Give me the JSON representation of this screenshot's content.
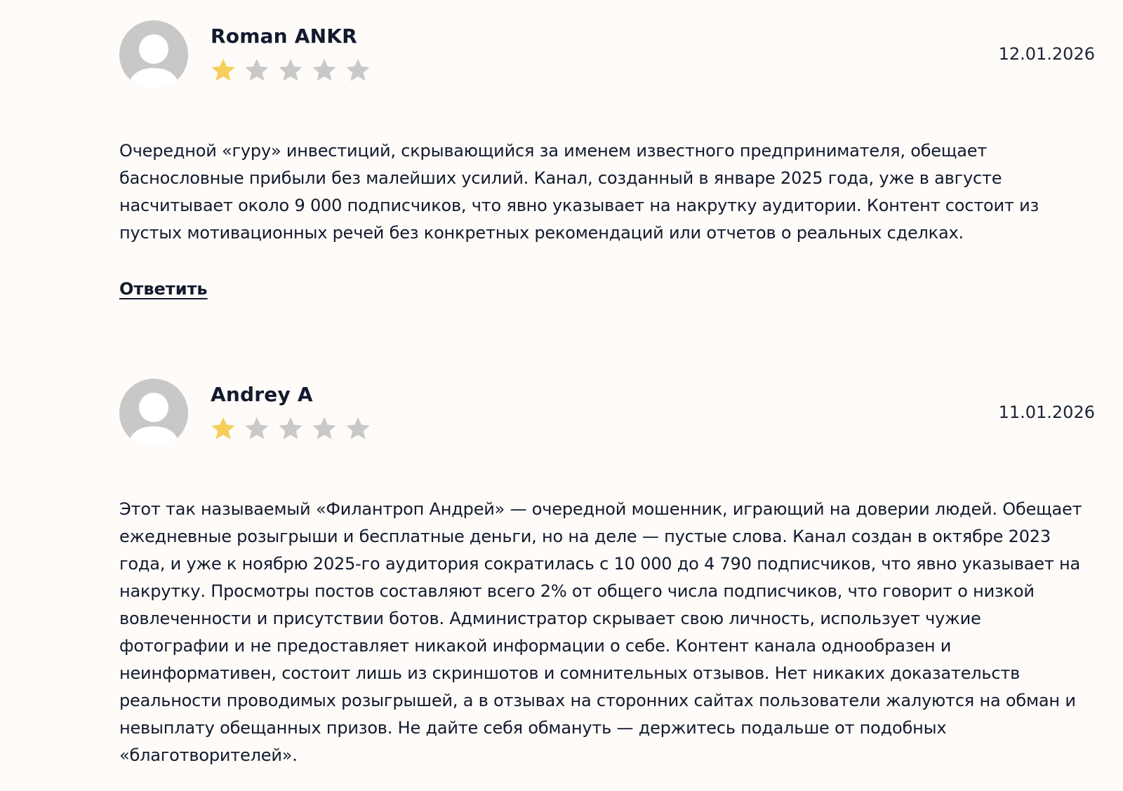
{
  "reviews": [
    {
      "author": "Roman ANKR",
      "date": "12.01.2026",
      "rating": 1,
      "rating_max": 5,
      "text": "Очередной «гуру» инвестиций, скрывающийся за именем известного предпринимателя, обещает баснословные прибыли без малейших усилий. Канал, созданный в январе 2025 года, уже в августе насчитывает около 9 000 подписчиков, что явно указывает на накрутку аудитории. Контент состоит из пустых мотивационных речей без конкретных рекомендаций или отчетов о реальных сделках.",
      "reply_label": "Ответить"
    },
    {
      "author": "Andrey A",
      "date": "11.01.2026",
      "rating": 1,
      "rating_max": 5,
      "text": "Этот так называемый «Филантроп Андрей» — очередной мошенник, играющий на доверии людей. Обещает ежедневные розыгрыши и бесплатные деньги, но на деле — пустые слова. Канал создан в октябре 2023 года, и уже к ноябрю 2025-го аудитория сократилась с 10 000 до 4 790 подписчиков, что явно указывает на накрутку. Просмотры постов составляют всего 2% от общего числа подписчиков, что говорит о низкой вовлеченности и присутствии ботов. Администратор скрывает свою личность, использует чужие фотографии и не предоставляет никакой информации о себе. Контент канала однообразен и неинформативен, состоит лишь из скриншотов и сомнительных отзывов. Нет никаких доказательств реальности проводимых розыгрышей, а в отзывах на сторонних сайтах пользователи жалуются на обман и невыплату обещанных призов. Не дайте себя обмануть — держитесь подальше от подобных «благотворителей»."
    }
  ],
  "colors": {
    "background": "#fefbf8",
    "text": "#131a2e",
    "star_filled": "#f5cf5a",
    "star_empty": "#c9c9c9",
    "avatar": "#c8c8c8"
  },
  "icons": {
    "avatar": "user-placeholder-icon",
    "star": "star-icon"
  }
}
